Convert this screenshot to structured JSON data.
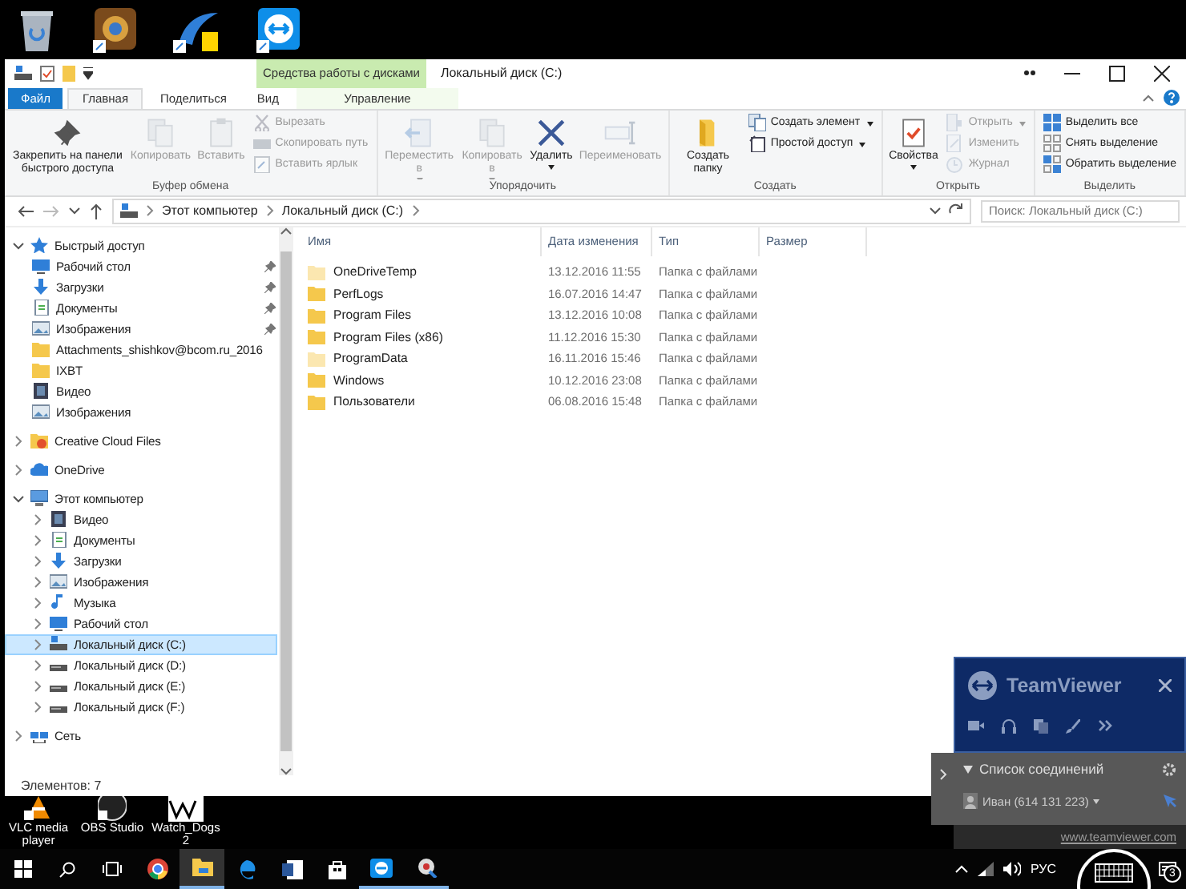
{
  "window": {
    "title": "Локальный диск (C:)",
    "context_group": "Средства работы с дисками"
  },
  "tabs": [
    {
      "label": "Файл",
      "kind": "file",
      "selected": false
    },
    {
      "label": "Главная",
      "kind": "normal",
      "selected": true
    },
    {
      "label": "Поделиться",
      "kind": "normal",
      "selected": false
    },
    {
      "label": "Вид",
      "kind": "normal",
      "selected": false
    },
    {
      "label": "Управление",
      "kind": "context",
      "selected": false
    }
  ],
  "ribbon": {
    "groups": [
      {
        "label": "Буфер обмена",
        "buttons": [
          {
            "kind": "large",
            "label": "Закрепить на панели быстрого доступа",
            "disabled": false,
            "dropdown": false
          },
          {
            "kind": "large",
            "label": "Копировать",
            "disabled": true,
            "dropdown": false
          },
          {
            "kind": "large",
            "label": "Вставить",
            "disabled": true,
            "dropdown": false
          },
          {
            "kind": "small",
            "label": "Вырезать",
            "disabled": true,
            "dropdown": false
          },
          {
            "kind": "small",
            "label": "Скопировать путь",
            "disabled": true,
            "dropdown": false
          },
          {
            "kind": "small",
            "label": "Вставить ярлык",
            "disabled": true,
            "dropdown": false
          }
        ]
      },
      {
        "label": "Упорядочить",
        "buttons": [
          {
            "kind": "large",
            "label": "Переместить в",
            "disabled": true,
            "dropdown": true
          },
          {
            "kind": "large",
            "label": "Копировать в",
            "disabled": true,
            "dropdown": true
          },
          {
            "kind": "large",
            "label": "Удалить",
            "disabled": false,
            "dropdown": true
          },
          {
            "kind": "large",
            "label": "Переименовать",
            "disabled": true,
            "dropdown": false
          }
        ]
      },
      {
        "label": "Создать",
        "buttons": [
          {
            "kind": "large",
            "label": "Создать папку",
            "disabled": false,
            "dropdown": false
          },
          {
            "kind": "small",
            "label": "Создать элемент",
            "disabled": false,
            "dropdown": true
          },
          {
            "kind": "small",
            "label": "Простой доступ",
            "disabled": false,
            "dropdown": true
          }
        ]
      },
      {
        "label": "Открыть",
        "buttons": [
          {
            "kind": "large",
            "label": "Свойства",
            "disabled": false,
            "dropdown": true
          },
          {
            "kind": "small",
            "label": "Открыть",
            "disabled": true,
            "dropdown": true
          },
          {
            "kind": "small",
            "label": "Изменить",
            "disabled": true,
            "dropdown": false
          },
          {
            "kind": "small",
            "label": "Журнал",
            "disabled": true,
            "dropdown": false
          }
        ]
      },
      {
        "label": "Выделить",
        "buttons": [
          {
            "kind": "small",
            "label": "Выделить все",
            "disabled": false,
            "dropdown": false
          },
          {
            "kind": "small",
            "label": "Снять выделение",
            "disabled": false,
            "dropdown": false
          },
          {
            "kind": "small",
            "label": "Обратить выделение",
            "disabled": false,
            "dropdown": false
          }
        ]
      }
    ]
  },
  "address_bar": {
    "path": [
      "Этот компьютер",
      "Локальный диск (C:)"
    ],
    "search_placeholder": "Поиск: Локальный диск (C:)"
  },
  "navigation": {
    "items": [
      {
        "label": "Быстрый доступ",
        "expanded": true,
        "selected": false,
        "children": [
          {
            "label": "Рабочий стол",
            "pinned": true,
            "selected": false
          },
          {
            "label": "Загрузки",
            "pinned": true,
            "selected": false
          },
          {
            "label": "Документы",
            "pinned": true,
            "selected": false
          },
          {
            "label": "Изображения",
            "pinned": true,
            "selected": false
          },
          {
            "label": "Attachments_shishkov@bcom.ru_2016",
            "pinned": false,
            "selected": false
          },
          {
            "label": "IXBT",
            "pinned": false,
            "selected": false
          },
          {
            "label": "Видео",
            "pinned": false,
            "selected": false
          },
          {
            "label": "Изображения",
            "pinned": false,
            "selected": false
          }
        ]
      },
      {
        "label": "Creative Cloud Files",
        "expanded": false,
        "selected": false
      },
      {
        "label": "OneDrive",
        "expanded": false,
        "selected": false
      },
      {
        "label": "Этот компьютер",
        "expanded": true,
        "selected": false,
        "children": [
          {
            "label": "Видео",
            "expanded": false,
            "selected": false
          },
          {
            "label": "Документы",
            "expanded": false,
            "selected": false
          },
          {
            "label": "Загрузки",
            "expanded": false,
            "selected": false
          },
          {
            "label": "Изображения",
            "expanded": false,
            "selected": false
          },
          {
            "label": "Музыка",
            "expanded": false,
            "selected": false
          },
          {
            "label": "Рабочий стол",
            "expanded": false,
            "selected": false
          },
          {
            "label": "Локальный диск (C:)",
            "expanded": false,
            "selected": true
          },
          {
            "label": "Локальный диск (D:)",
            "expanded": false,
            "selected": false
          },
          {
            "label": "Локальный диск (E:)",
            "expanded": false,
            "selected": false
          },
          {
            "label": "Локальный диск (F:)",
            "expanded": false,
            "selected": false
          }
        ]
      },
      {
        "label": "Сеть",
        "expanded": false,
        "selected": false
      }
    ]
  },
  "file_list": {
    "columns": [
      "Имя",
      "Дата изменения",
      "Тип",
      "Размер"
    ],
    "rows": [
      {
        "name": "OneDriveTemp",
        "date": "13.12.2016 11:55",
        "type": "Папка с файлами",
        "hidden": true
      },
      {
        "name": "PerfLogs",
        "date": "16.07.2016 14:47",
        "type": "Папка с файлами",
        "hidden": false
      },
      {
        "name": "Program Files",
        "date": "13.12.2016 10:08",
        "type": "Папка с файлами",
        "hidden": false
      },
      {
        "name": "Program Files (x86)",
        "date": "11.12.2016 15:30",
        "type": "Папка с файлами",
        "hidden": false
      },
      {
        "name": "ProgramData",
        "date": "16.11.2016 15:46",
        "type": "Папка с файлами",
        "hidden": true
      },
      {
        "name": "Windows",
        "date": "10.12.2016 23:08",
        "type": "Папка с файлами",
        "hidden": false
      },
      {
        "name": "Пользователи",
        "date": "06.08.2016 15:48",
        "type": "Папка с файлами",
        "hidden": false
      }
    ]
  },
  "status_bar": {
    "item_count": "Элементов: 7"
  },
  "desktop_shortcuts": [
    {
      "label": "VLC media player"
    },
    {
      "label": "OBS Studio"
    },
    {
      "label": "Watch_Dogs 2"
    }
  ],
  "taskbar": {
    "apps": [
      {
        "running": false,
        "active": false
      },
      {
        "running": true,
        "active": true
      },
      {
        "running": false,
        "active": false
      },
      {
        "running": false,
        "active": false
      },
      {
        "running": false,
        "active": false
      },
      {
        "running": true,
        "active": false
      },
      {
        "running": true,
        "active": false
      }
    ],
    "language": "РУС",
    "notification_count": "3"
  },
  "teamviewer": {
    "title": "TeamViewer",
    "connections_label": "Список соединений",
    "contact": "Иван (614 131 223)",
    "link": "www.teamviewer.com"
  }
}
